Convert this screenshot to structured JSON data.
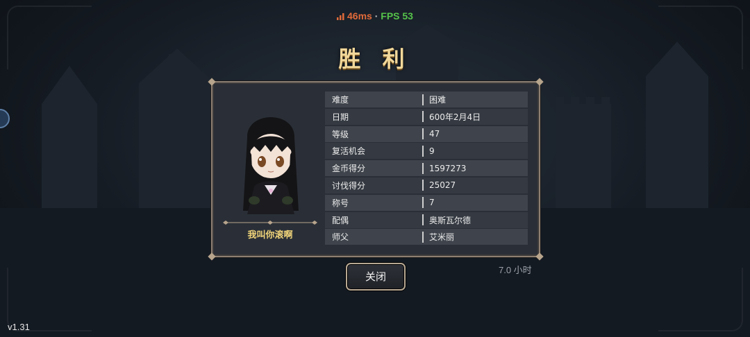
{
  "network": {
    "ping": "46ms",
    "separator": "·",
    "fps": "FPS 53",
    "ping_color": "#e06a3a",
    "fps_color": "#55c24a"
  },
  "title": "胜 利",
  "character": {
    "name": "我叫你滚啊"
  },
  "stats": [
    {
      "label": "难度",
      "value": "困难"
    },
    {
      "label": "日期",
      "value": "600年2月4日"
    },
    {
      "label": "等级",
      "value": "47"
    },
    {
      "label": "复活机会",
      "value": "9"
    },
    {
      "label": "金币得分",
      "value": "1597273"
    },
    {
      "label": "讨伐得分",
      "value": "25027"
    },
    {
      "label": "称号",
      "value": "7"
    },
    {
      "label": "配偶",
      "value": "奥斯瓦尔德"
    },
    {
      "label": "师父",
      "value": "艾米丽"
    }
  ],
  "close_label": "关闭",
  "playtime": "7.0 小时",
  "version": "v1.31",
  "colors": {
    "title": "#f2d89a",
    "name": "#f0d47a",
    "panel": "#2a2f37",
    "panel_border": "#8d7f72"
  }
}
